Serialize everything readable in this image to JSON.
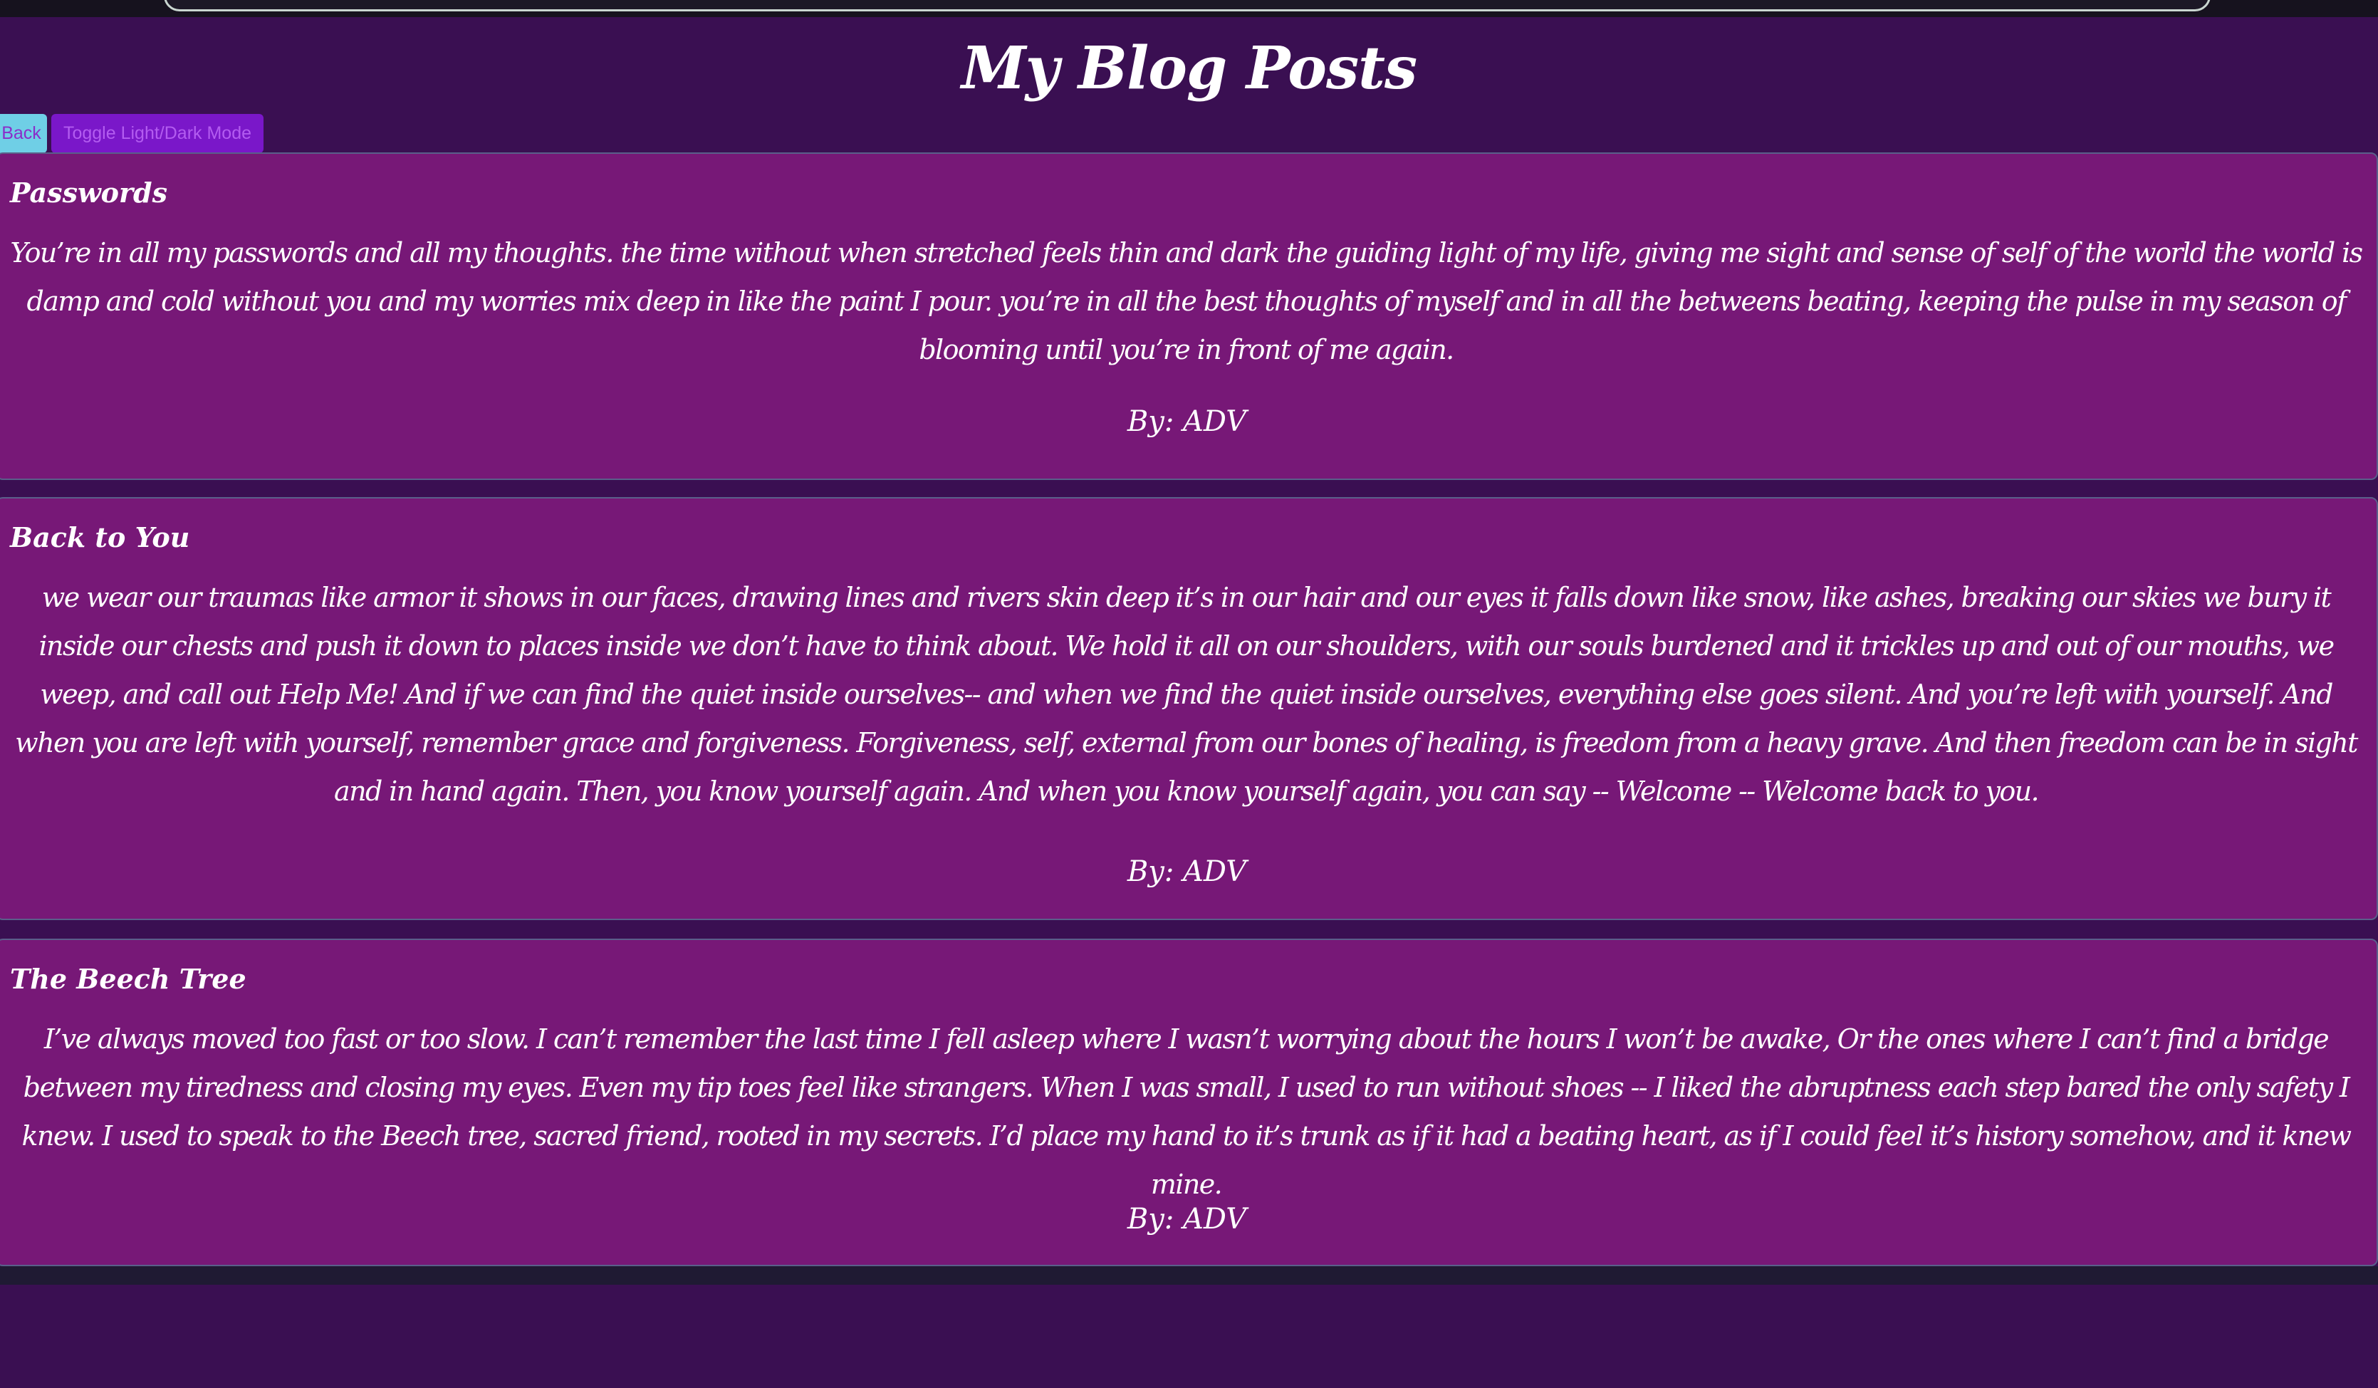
{
  "page": {
    "title": "My Blog Posts"
  },
  "controls": {
    "back_label": "Back",
    "toggle_label": "Toggle Light/Dark Mode"
  },
  "posts": [
    {
      "title": "Passwords",
      "body": "You’re in all my passwords and all my thoughts. the time without when stretched feels thin and dark the guiding light of my life, giving me sight and sense of self of the world the world is damp and cold without you and my worries mix deep in like the paint I pour. you’re in all the best thoughts of myself and in all the betweens beating, keeping the pulse in my season of blooming until you’re in front of me again.",
      "author": "By: ADV"
    },
    {
      "title": "Back to You",
      "body": "we wear our traumas like armor it shows in our faces, drawing lines and rivers skin deep it’s in our hair and our eyes it falls down like snow, like ashes, breaking our skies we bury it inside our chests and push it down to places inside we don’t have to think about. We hold it all on our shoulders, with our souls burdened and it trickles up and out of our mouths, we weep, and call out Help Me! And if we can find the quiet inside ourselves-- and when we find the quiet inside ourselves, everything else goes silent. And you’re left with yourself. And when you are left with yourself, remember grace and forgiveness. Forgiveness, self, external from our bones of healing, is freedom from a heavy grave. And then freedom can be in sight and in hand again. Then, you know yourself again. And when you know yourself again, you can say -- Welcome -- Welcome back to you.",
      "author": "By: ADV"
    },
    {
      "title": "The Beech Tree",
      "body": "I’ve always moved too fast or too slow. I can’t remember the last time I fell asleep where I wasn’t worrying about the hours I won’t be awake, Or the ones where I can’t find a bridge between my tiredness and closing my eyes. Even my tip toes feel like strangers. When I was small, I used to run without shoes -- I liked the abruptness each step bared the only safety I knew. I used to speak to the Beech tree, sacred friend, rooted in my secrets. I’d place my hand to it’s trunk as if it had a beating heart, as if I could feel it’s history somehow, and it knew mine.",
      "author": "By: ADV"
    }
  ],
  "colors": {
    "page_background": "#3a0f52",
    "card_background": "#771877",
    "card_border": "#5a5f8a",
    "back_button": "#6fcfe6",
    "toggle_button": "#7a17c9",
    "text": "#ffffff"
  }
}
